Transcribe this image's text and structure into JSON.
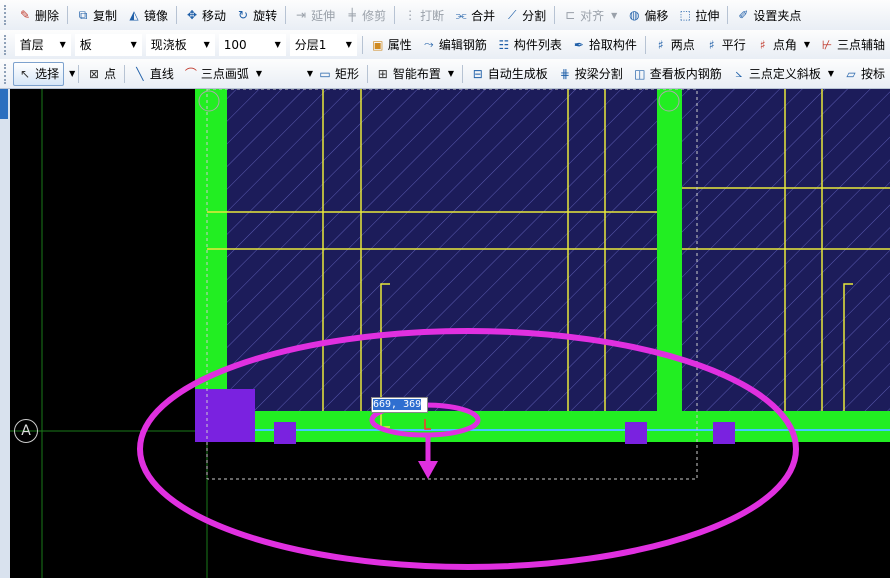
{
  "toolbar_edit": {
    "delete": "删除",
    "copy": "复制",
    "mirror": "镜像",
    "move": "移动",
    "rotate": "旋转",
    "extend": "延伸",
    "trim": "修剪",
    "break": "打断",
    "merge": "合并",
    "split": "分割",
    "align": "对齐",
    "offset": "偏移",
    "stretch": "拉伸",
    "set_grip": "设置夹点"
  },
  "toolbar_props": {
    "floor": "首层",
    "component_type": "板",
    "sub_type": "现浇板",
    "thickness": "100",
    "layer": "分层1",
    "properties": "属性",
    "edit_rebar": "编辑钢筋",
    "component_list": "构件列表",
    "pick_component": "拾取构件",
    "two_points": "两点",
    "parallel": "平行",
    "point_angle": "点角",
    "three_point_aux": "三点辅轴"
  },
  "toolbar_draw": {
    "select": "选择",
    "point": "点",
    "line": "直线",
    "three_point_arc": "三点画弧",
    "rectangle": "矩形",
    "smart_layout": "智能布置",
    "auto_generate_slab": "自动生成板",
    "split_by_beam": "按梁分割",
    "view_slab_rebar": "查看板内钢筋",
    "three_point_slope": "三点定义斜板",
    "by_standard": "按标"
  },
  "canvas": {
    "axis_label": "A",
    "coord_input": "669, 369",
    "colors": {
      "slab_fill": "#1c1c5a",
      "hatch": "#5a5ab0",
      "beam": "#22ee22",
      "rebar": "#e8e83a",
      "column": "#7a22e0",
      "annotation": "#e030e0",
      "grid": "#1a7a1a"
    }
  }
}
